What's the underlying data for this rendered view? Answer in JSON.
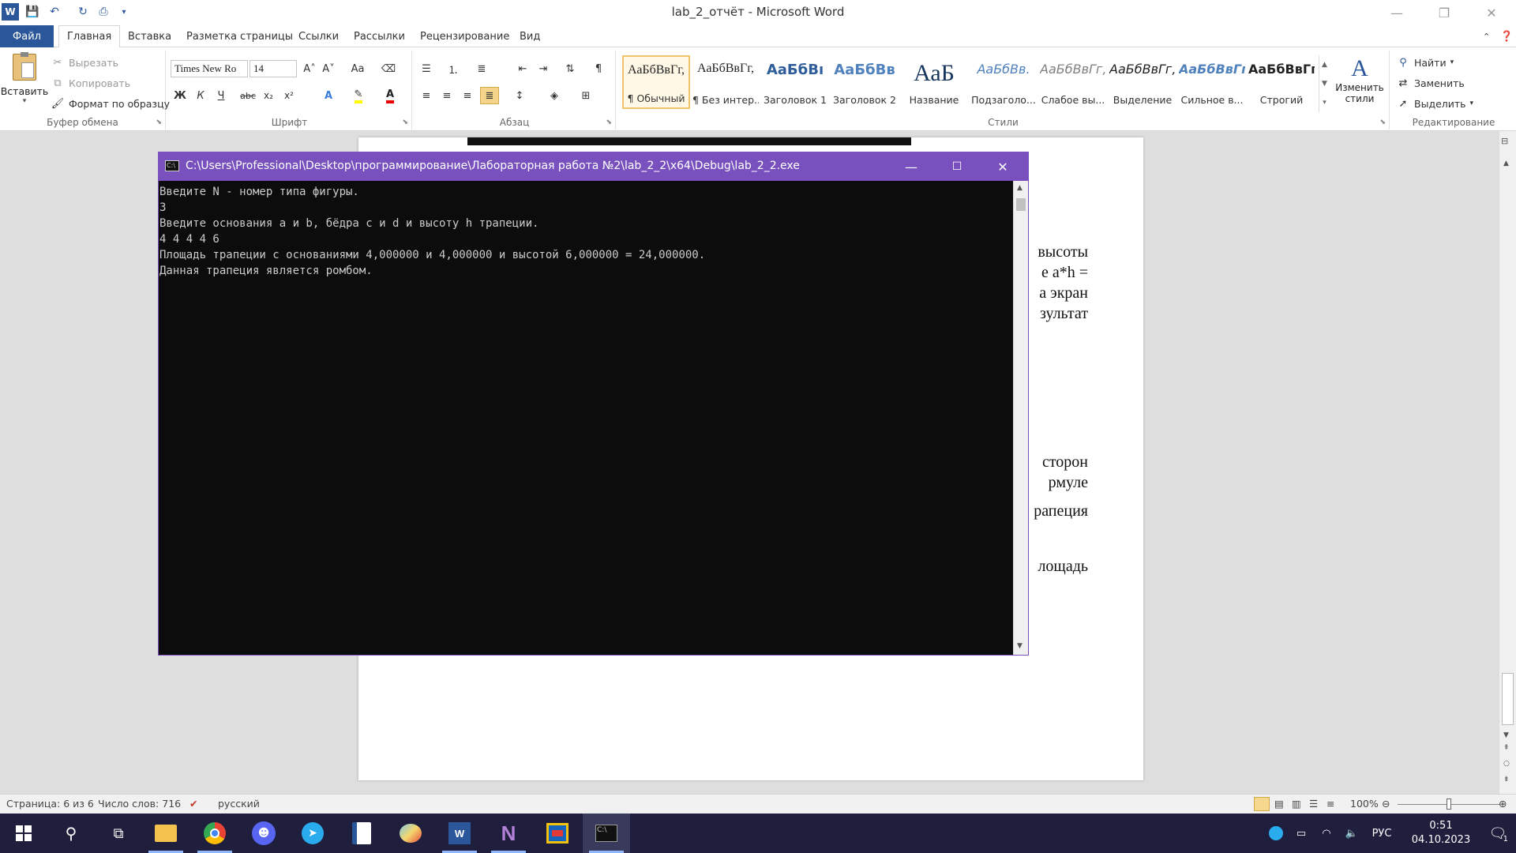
{
  "window": {
    "doc_title": "lab_2_отчёт - Microsoft Word",
    "minimize_glyph": "—",
    "restore_glyph": "❐",
    "close_glyph": "✕"
  },
  "tabs": [
    "Файл",
    "Главная",
    "Вставка",
    "Разметка страницы",
    "Ссылки",
    "Рассылки",
    "Рецензирование",
    "Вид"
  ],
  "clipboard": {
    "paste": "Вставить",
    "cut": "Вырезать",
    "copy": "Копировать",
    "format_painter": "Формат по образцу",
    "label": "Буфер обмена"
  },
  "font": {
    "name": "Times New Ro",
    "size": "14",
    "label": "Шрифт",
    "bold": "Ж",
    "italic": "К",
    "underline": "Ч",
    "strike": "abc",
    "subscript": "x₂",
    "superscript": "x²",
    "grow": "A˄",
    "shrink": "A˅",
    "case": "Aa"
  },
  "paragraph": {
    "label": "Абзац",
    "pilcrow": "¶"
  },
  "styles": {
    "label": "Стили",
    "items": [
      {
        "sample": "АаБбВвГг,",
        "name": "¶ Обычный"
      },
      {
        "sample": "АаБбВвГг,",
        "name": "¶ Без интер..."
      },
      {
        "sample": "АаБбВı",
        "name": "Заголовок 1"
      },
      {
        "sample": "АаБбВв",
        "name": "Заголовок 2"
      },
      {
        "sample": "АаБ",
        "name": "Название"
      },
      {
        "sample": "АаБбВв.",
        "name": "Подзаголо..."
      },
      {
        "sample": "АаБбВвГг,",
        "name": "Слабое вы..."
      },
      {
        "sample": "АаБбВвГг,",
        "name": "Выделение"
      },
      {
        "sample": "АаБбВвГг",
        "name": "Сильное в..."
      },
      {
        "sample": "АаБбВвГг,",
        "name": "Строгий"
      }
    ],
    "change": "Изменить стили"
  },
  "editing": {
    "find": "Найти",
    "replace": "Заменить",
    "select": "Выделить",
    "label": "Редактирование"
  },
  "page_text": [
    "высоты",
    "е a*h =",
    "а экран",
    "зультат",
    "сторон",
    "рмуле",
    "рапеция",
    "лощадь"
  ],
  "console": {
    "title": "C:\\Users\\Professional\\Desktop\\программирование\\Лабораторная работа №2\\lab_2_2\\x64\\Debug\\lab_2_2.exe",
    "lines": [
      "Введите N - номер типа фигуры.",
      "3",
      "Введите основания a и b, бёдра c и d и высоту h трапеции.",
      "4 4 4 4 6",
      "Площадь трапеции с основаниями 4,000000 и 4,000000 и высотой 6,000000 = 24,000000.",
      "Данная трапеция является ромбом."
    ]
  },
  "status": {
    "page": "Страница: 6 из 6",
    "words": "Число слов: 716",
    "lang": "русский",
    "zoom": "100%"
  },
  "tray": {
    "lang": "РУС",
    "time": "0:51",
    "date": "04.10.2023",
    "notif": "1"
  },
  "colors": {
    "word_blue": "#2b579a",
    "console_title": "#7951be",
    "taskbar": "#1f1f3d"
  }
}
